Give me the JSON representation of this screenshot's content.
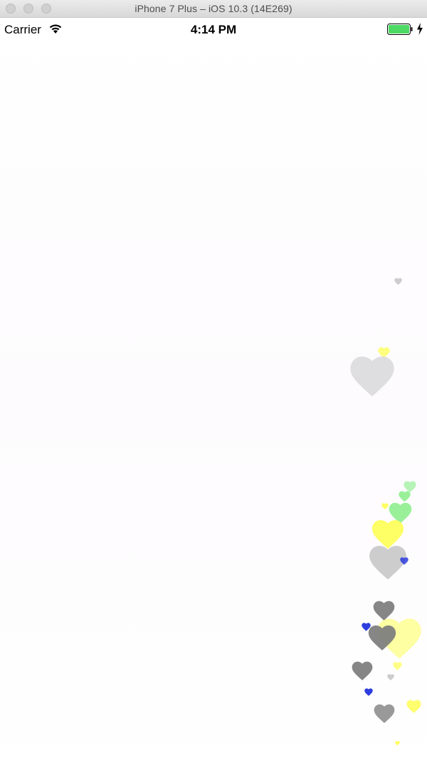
{
  "window": {
    "title": "iPhone 7 Plus – iOS 10.3 (14E269)",
    "controls": [
      "close-button",
      "minimize-button",
      "zoom-button"
    ]
  },
  "status_bar": {
    "carrier": "Carrier",
    "time": "4:14 PM",
    "wifi_icon": "wifi-icon",
    "battery_icon": "battery-icon",
    "charging_icon": "charging-bolt-icon",
    "battery_color": "#4cd964"
  },
  "hearts": {
    "icon": "heart-icon",
    "colors": {
      "light_gray": "#d9d9dc",
      "gray": "#c8c8c8",
      "dark_gray": "#808080",
      "yellow": "#ffff55",
      "pale_yellow": "#ffff99",
      "green": "#88ee88",
      "blue": "#2233dd"
    }
  }
}
